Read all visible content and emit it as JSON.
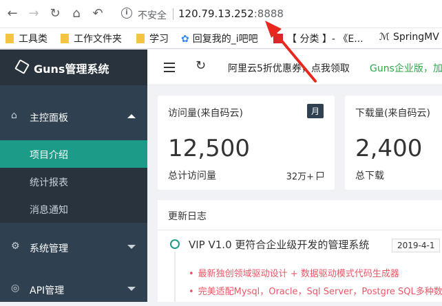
{
  "browser": {
    "insecure_label": "不安全",
    "url_host": "120.79.13.252",
    "url_port": ":8888",
    "bookmarks": [
      "工具类",
      "工作文件夹",
      "学习",
      "回复我的_i吧吧",
      "【 分类 】- 《E...",
      "SpringMV"
    ]
  },
  "app": {
    "title": "Guns管理系统"
  },
  "sidebar": {
    "groups": [
      {
        "label": "主控面板",
        "items": [
          "项目介绍",
          "统计报表",
          "消息通知"
        ]
      },
      {
        "label": "系统管理"
      },
      {
        "label": "API管理"
      }
    ]
  },
  "topbar": {
    "promo": "阿里云5折优惠券，点我领取",
    "enterprise": "Guns企业版，加"
  },
  "cards": [
    {
      "title": "访问量(来自码云)",
      "badge": "月",
      "value": "12,500",
      "footer": "总计访问量",
      "stat": "32万+"
    },
    {
      "title": "下载量(来自码云)",
      "value": "2,400",
      "footer": "总下载"
    }
  ],
  "changelog": {
    "title": "更新日志",
    "version": "VIP V1.0 更符合企业级开发的管理系统",
    "date": "2019-4-1",
    "items": [
      "最新独创领域驱动设计 + 数据驱动模式代码生成器",
      "完美适配Mysql，Oracle，Sql Server，Postgre SQL多种数"
    ]
  },
  "colors": {
    "sidebar": "#2f4050",
    "active": "#1d9b89",
    "accent_red": "#ed5565",
    "enterprise_green": "#2ea64a"
  }
}
